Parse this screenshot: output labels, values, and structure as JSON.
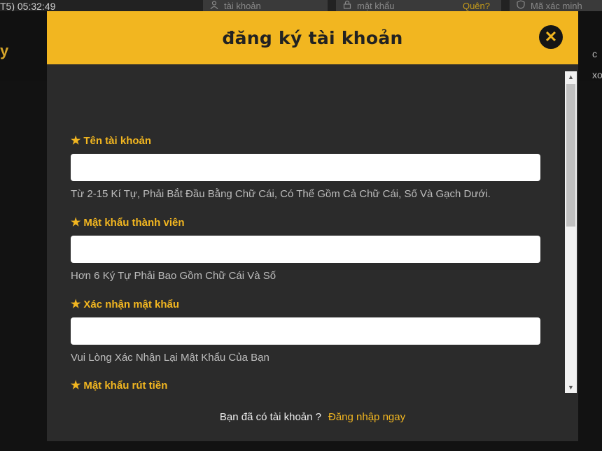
{
  "background": {
    "clock": "T5) 05:32:49",
    "username_placeholder": "tài khoản",
    "password_placeholder": "mật khẩu",
    "forgot_label": "Quên?",
    "captcha_placeholder": "Mã xác minh",
    "logo_glyph": "y",
    "right_glyphs": [
      "c",
      "xo"
    ]
  },
  "modal": {
    "title": "đăng ký tài khoản",
    "close_glyph": "✕",
    "fields": [
      {
        "label": "Tên tài khoản",
        "hint": "Từ 2-15 Kí Tự, Phải Bắt Đầu Bằng Chữ Cái, Có Thể Gồm Cả Chữ Cái, Số Và Gạch Dưới.",
        "value": ""
      },
      {
        "label": "Mật khẩu thành viên",
        "hint": "Hơn 6 Ký Tự Phải Bao Gồm Chữ Cái Và Số",
        "value": ""
      },
      {
        "label": "Xác nhận mật khẩu",
        "hint": "Vui Lòng Xác Nhận Lại Mật Khẩu Của Bạn",
        "value": ""
      },
      {
        "label": "Mật khẩu rút tiền"
      }
    ],
    "footer": {
      "text": "Bạn đã có tài khoản ?",
      "login_link": "Đăng nhập ngay"
    }
  },
  "icons": {
    "star": "★",
    "user": "user-icon",
    "lock": "lock-icon",
    "shield": "shield-icon"
  },
  "colors": {
    "accent": "#f2b620",
    "modal_bg": "#2b2b2b",
    "hint_text": "#bdbdbd"
  }
}
